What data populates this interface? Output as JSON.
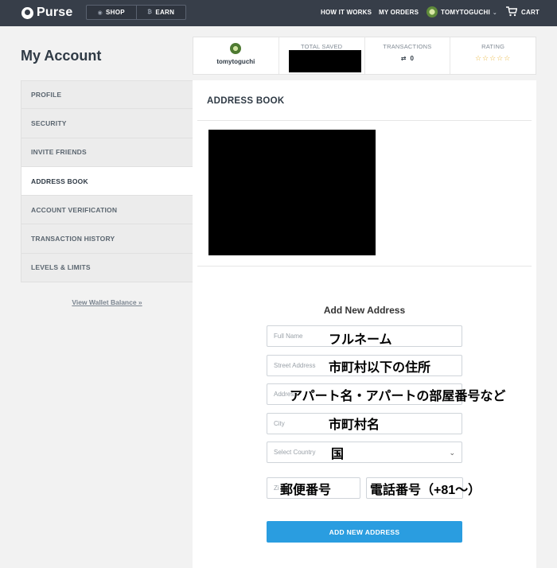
{
  "nav": {
    "brand": "Purse",
    "shop_label": "SHOP",
    "earn_label": "EARN",
    "how_it_works": "HOW IT WORKS",
    "my_orders": "MY ORDERS",
    "username": "TOMYTOGUCHI",
    "cart_label": "CART"
  },
  "page": {
    "title": "My Account"
  },
  "stats": {
    "username": "tomytoguchi",
    "total_saved_label": "TOTAL SAVED",
    "transactions_label": "TRANSACTIONS",
    "transactions_value": "0",
    "rating_label": "RATING",
    "rating_stars": "☆☆☆☆☆"
  },
  "sidebar": {
    "items": [
      {
        "label": "PROFILE"
      },
      {
        "label": "SECURITY"
      },
      {
        "label": "INVITE FRIENDS"
      },
      {
        "label": "ADDRESS BOOK"
      },
      {
        "label": "ACCOUNT VERIFICATION"
      },
      {
        "label": "TRANSACTION HISTORY"
      },
      {
        "label": "LEVELS & LIMITS"
      }
    ],
    "active": "ADDRESS BOOK",
    "wallet_link": "View Wallet Balance »"
  },
  "address_book": {
    "title": "ADDRESS BOOK",
    "form_title": "Add New Address",
    "fields": {
      "full_name": {
        "placeholder": "Full Name",
        "note": "フルネーム"
      },
      "street": {
        "placeholder": "Street Address",
        "note": "市町村以下の住所"
      },
      "address2": {
        "placeholder": "Address",
        "note": "アパート名・アパートの部屋番号など"
      },
      "city": {
        "placeholder": "City",
        "note": "市町村名"
      },
      "country": {
        "placeholder": "Select Country",
        "note": "国"
      },
      "zip": {
        "placeholder": "Zi",
        "note": "郵便番号"
      },
      "phone": {
        "placeholder": "",
        "note": "電話番号（+81～）"
      }
    },
    "submit_label": "ADD NEW ADDRESS"
  },
  "colors": {
    "topbar": "#373e49",
    "accent": "#2a9de0",
    "stars": "#e9b53a"
  }
}
